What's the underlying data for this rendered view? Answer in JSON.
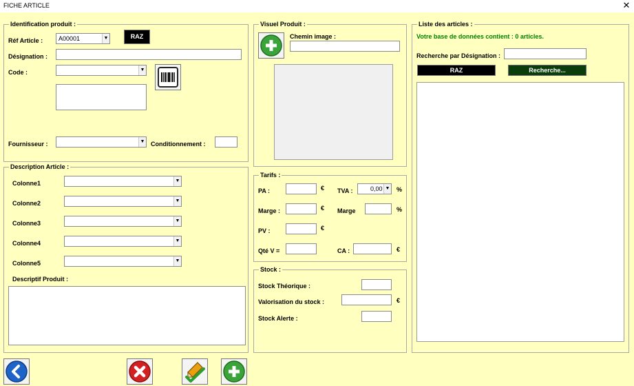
{
  "window": {
    "title": "FICHE ARTICLE",
    "close_glyph": "✕"
  },
  "identification": {
    "legend": "Identification produit :",
    "ref_label": "Réf Article :",
    "ref_value": "A00001",
    "raz_label": "RAZ",
    "designation_label": "Désignation :",
    "code_label": "Code :",
    "fournisseur_label": "Fournisseur :",
    "conditionnement_label": "Conditionnement :"
  },
  "description": {
    "legend": "Description Article :",
    "columns": [
      "Colonne1",
      "Colonne2",
      "Colonne3",
      "Colonne4",
      "Colonne5"
    ],
    "descriptif_label": "Descriptif Produit :"
  },
  "visuel": {
    "legend": "Visuel Produit :",
    "chemin_label": "Chemin image :"
  },
  "tarifs": {
    "legend": "Tarifs :",
    "pa_label": "PA :",
    "tva_label": "TVA :",
    "tva_value": "0,00",
    "marge_label": "Marge :",
    "marge2_label": "Marge",
    "pv_label": "PV :",
    "qte_label": "Qté V =",
    "ca_label": "CA :",
    "euro": "€",
    "percent": "%"
  },
  "stock": {
    "legend": "Stock :",
    "theorique_label": "Stock Théorique :",
    "valorisation_label": "Valorisation du stock :",
    "alerte_label": "Stock Alerte :",
    "euro": "€"
  },
  "liste": {
    "legend": "Liste des articles :",
    "status": "Votre base de données contient : 0 articles.",
    "status_color": "#008000",
    "recherche_label": "Recherche  par Désignation :",
    "raz_label": "RAZ",
    "recherche_button": "Recherche..."
  },
  "colors": {
    "background": "#ffffc0",
    "accent_green": "#3aa33a",
    "back_blue": "#1e64c8",
    "delete_red": "#d42020"
  }
}
